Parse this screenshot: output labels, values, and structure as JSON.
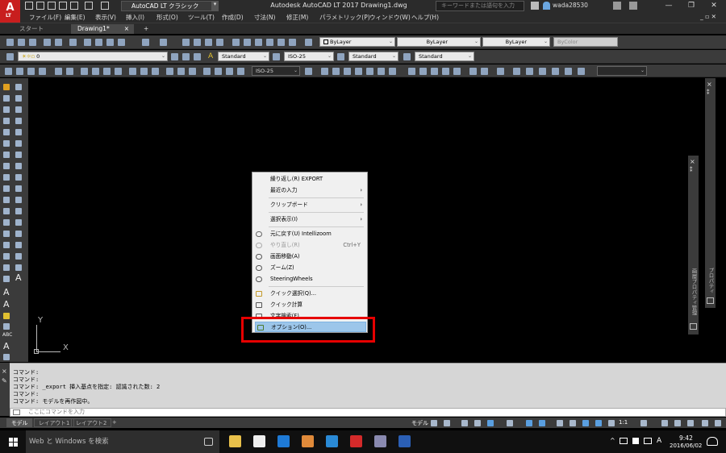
{
  "window": {
    "title": "Autodesk AutoCAD LT 2017   Drawing1.dwg",
    "workspace": "AutoCAD LT クラシック",
    "search_placeholder": "キーワードまたは語句を入力",
    "user": "wada28530",
    "app_logo": "A",
    "app_logo_sub": "LT",
    "controls": [
      "—",
      "❐",
      "✕"
    ]
  },
  "menubar": {
    "items": [
      "ファイル(F)",
      "編集(E)",
      "表示(V)",
      "挿入(I)",
      "形式(O)",
      "ツール(T)",
      "作成(D)",
      "寸法(N)",
      "修正(M)",
      "パラメトリック(P)",
      "ウィンドウ(W)",
      "ヘルプ(H)"
    ],
    "right": "_ ▫ ✕"
  },
  "tabs": {
    "start": "スタート",
    "drawing": "Drawing1*",
    "close": "×",
    "new": "+"
  },
  "toolbar1": {
    "layer_color": "ByLayer",
    "linetype": "ByLayer",
    "lineweight": "ByLayer",
    "plot_style": "ByColor"
  },
  "toolbar2": {
    "layer": "0",
    "text_style": "Standard",
    "dim_style": "ISO-25",
    "table_style": "Standard",
    "mleader_style": "Standard"
  },
  "toolbar3": {
    "dim_style": "ISO-25"
  },
  "canvas": {
    "ucs_x": "X",
    "ucs_y": "Y"
  },
  "side_panels": {
    "properties": "プロパティ",
    "tool_palettes": "画層プロパティ管理"
  },
  "context_menu": {
    "items": [
      {
        "label": "繰り返し(R) EXPORT"
      },
      {
        "label": "最近の入力",
        "submenu": true
      },
      {
        "label": "クリップボード",
        "submenu": true
      },
      {
        "label": "選択表示(I)",
        "submenu": true
      },
      {
        "label": "元に戻す(U) Intellizoom"
      },
      {
        "label": "やり直し(R)",
        "shortcut": "Ctrl+Y",
        "disabled": true
      },
      {
        "label": "画面移動(A)"
      },
      {
        "label": "ズーム(Z)"
      },
      {
        "label": "SteeringWheels"
      },
      {
        "label": "クイック選択(Q)..."
      },
      {
        "label": "クイック計算"
      },
      {
        "label": "文字検索(F)..."
      },
      {
        "label": "オプション(O)...",
        "highlighted": true
      }
    ],
    "chevron": "›"
  },
  "command_line": {
    "history": [
      "コマンド:",
      "コマンド:",
      "コマンド: _export 挿入基点を指定: 認識された数: 2",
      "コマンド:",
      "コマンド: モデルを再作図中。"
    ],
    "input_placeholder": "ここにコマンドを入力"
  },
  "layout_tabs": [
    "モデル",
    "レイアウト1",
    "レイアウト2",
    "+"
  ],
  "status_bar": {
    "model": "モデル",
    "scale": "1:1"
  },
  "taskbar": {
    "search": "Web と Windows を検索",
    "time": "9:42",
    "date": "2016/06/02",
    "ime": "A"
  },
  "colors": {
    "accent_red": "#e60000",
    "highlight_blue": "#9cc6ea",
    "canvas": "#000000"
  }
}
